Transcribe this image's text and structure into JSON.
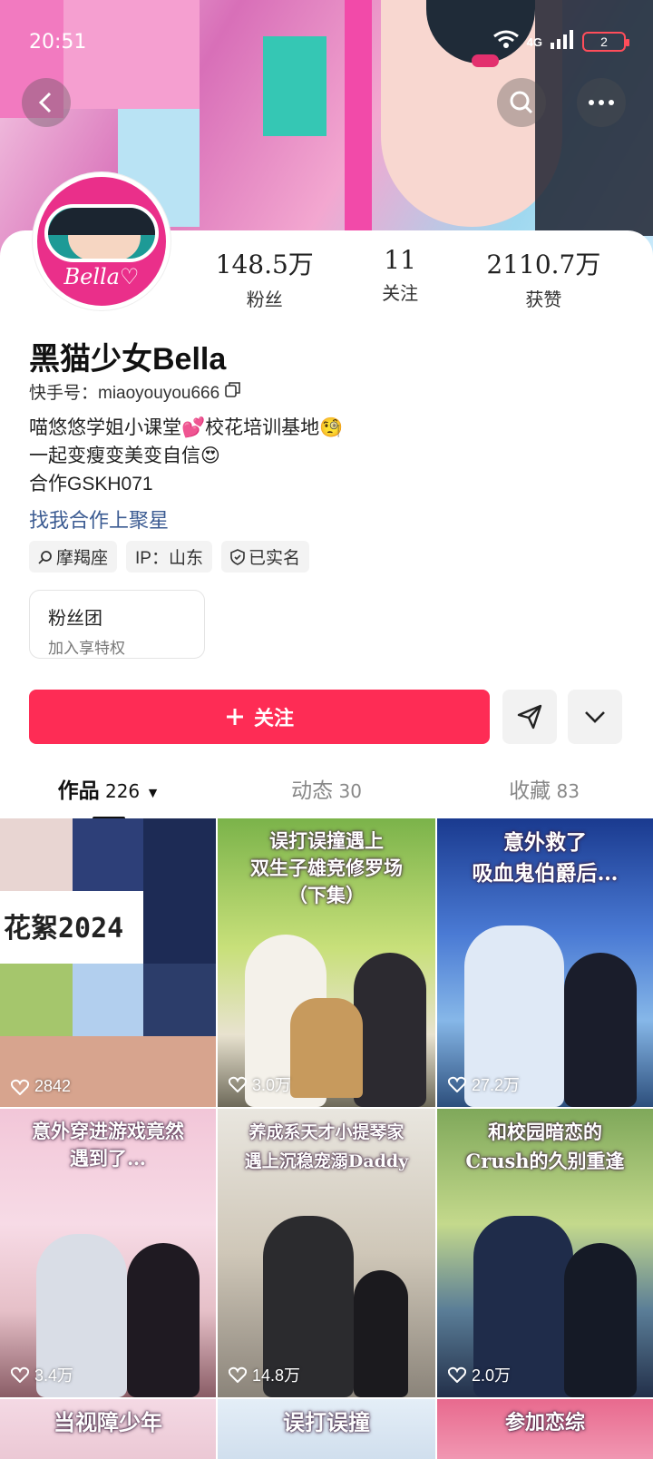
{
  "status": {
    "time": "20:51",
    "network": "4G",
    "battery": "2"
  },
  "profile": {
    "name": "黑猫少女Bella",
    "uid_label": "快手号：miaoyouyou666",
    "bio_line1": "喵悠悠学姐小课堂💕校花培训基地🧐",
    "bio_line2": "一起变瘦变美变自信😍",
    "bio_line3": "合作GSKH071",
    "link": "找我合作上聚星",
    "avatar_text": "Bella♡"
  },
  "stats": [
    {
      "num": "148.5万",
      "label": "粉丝"
    },
    {
      "num": "11",
      "label": "关注"
    },
    {
      "num": "2110.7万",
      "label": "获赞"
    }
  ],
  "tags": [
    {
      "icon": "search-icon",
      "text": "摩羯座"
    },
    {
      "icon": "",
      "text": "IP：山东"
    },
    {
      "icon": "verified-shield-icon",
      "text": "已实名"
    }
  ],
  "fans_club": {
    "title": "粉丝团",
    "subtitle": "加入享特权"
  },
  "follow_label": "关注",
  "tabs": [
    {
      "label": "作品",
      "count": "226"
    },
    {
      "label": "动态",
      "count": "30"
    },
    {
      "label": "收藏",
      "count": "83"
    }
  ],
  "videos": [
    {
      "caption": "",
      "overlay": "花絮2024",
      "likes": "2842"
    },
    {
      "caption": "误打误撞遇上\n双生子雄竞修罗场\n（下集）",
      "likes": "3.0万"
    },
    {
      "caption": "意外救了\n吸血鬼伯爵后…",
      "likes": "27.2万"
    },
    {
      "caption": "意外穿进游戏竟然\n遇到了…",
      "likes": "3.4万"
    },
    {
      "caption": "养成系天才小提琴家\n遇上沉稳宠溺Daddy",
      "likes": "14.8万"
    },
    {
      "caption": "和校园暗恋的\nCrush的久别重逢",
      "likes": "2.0万"
    },
    {
      "caption": "当视障少年",
      "likes": ""
    },
    {
      "caption": "误打误撞",
      "likes": ""
    },
    {
      "caption": "参加恋综",
      "likes": ""
    }
  ],
  "colors": {
    "accent": "#fe2c55",
    "link": "#3b5b92"
  }
}
